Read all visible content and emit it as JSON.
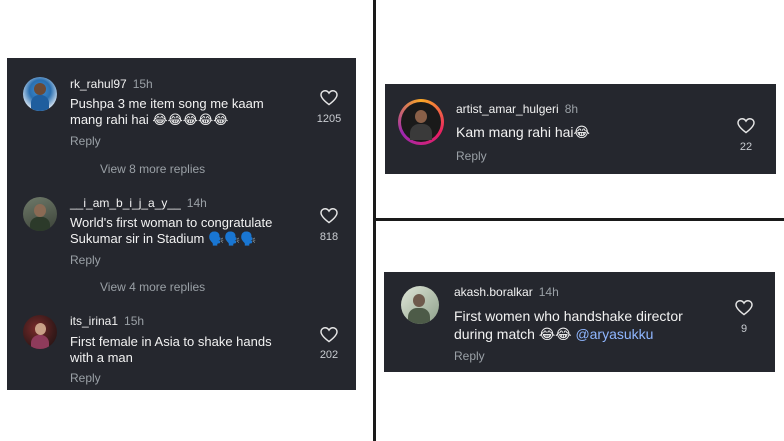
{
  "left_panel": {
    "comments": [
      {
        "username": "rk_rahul97",
        "time": "15h",
        "text_line1": "Pushpa 3 me item song me kaam",
        "text_line2": "mang rahi hai 😂😂😂😂😂",
        "reply_label": "Reply",
        "likes": "1205",
        "more_replies": "View 8 more replies"
      },
      {
        "username": "__i_am_b_i_j_a_y__",
        "time": "14h",
        "text_line1": "World's first woman to congratulate",
        "text_line2": "Sukumar sir in Stadium 🗣️🗣️🗣️",
        "reply_label": "Reply",
        "likes": "818",
        "more_replies": "View 4 more replies"
      },
      {
        "username": "its_irina1",
        "time": "15h",
        "text_line1": "First female in Asia to shake hands",
        "text_line2": "with a man",
        "reply_label": "Reply",
        "likes": "202"
      }
    ]
  },
  "top_right_panel": {
    "username": "artist_amar_hulgeri",
    "time": "8h",
    "text": "Kam mang rahi hai😂",
    "reply_label": "Reply",
    "likes": "22"
  },
  "bottom_right_panel": {
    "username": "akash.boralkar",
    "time": "14h",
    "text_line1": "First women who handshake director",
    "text_line2_prefix": "during match 😂😂",
    "mention": "@aryasukku",
    "reply_label": "Reply",
    "likes": "9"
  },
  "colors": {
    "panel_bg": "#25272e",
    "text": "#f2f2f2",
    "muted": "#9aa0a6",
    "mention": "#8fb6ff"
  }
}
